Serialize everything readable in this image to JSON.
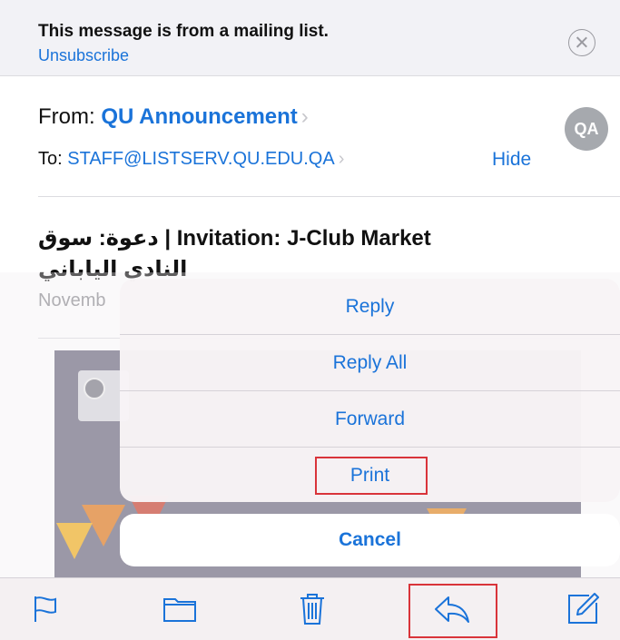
{
  "banner": {
    "message": "This message is from a mailing list.",
    "unsubscribe_label": "Unsubscribe",
    "close_icon": "close-circle-icon"
  },
  "header": {
    "from_prefix": "From:",
    "from_name": "QU Announcement",
    "to_prefix": "To:",
    "to_address": "STAFF@LISTSERV.QU.EDU.QA",
    "chevron": "›",
    "hide_label": "Hide",
    "avatar_initials": "QA"
  },
  "message": {
    "subject_line1": "دعوة: سوق | Invitation: J-Club Market",
    "subject_line2": "النادي الياباني",
    "date_partial": "Novemb"
  },
  "action_sheet": {
    "items": [
      "Reply",
      "Reply All",
      "Forward",
      "Print"
    ],
    "cancel_label": "Cancel",
    "highlighted_item": "Print"
  },
  "toolbar": {
    "icons": [
      "flag-icon",
      "folder-icon",
      "trash-icon",
      "reply-icon",
      "compose-icon"
    ],
    "highlighted_icon": "reply-icon"
  },
  "colors": {
    "accent": "#1a73d9",
    "highlight_box": "#d9343a",
    "banner_bg": "#f2f2f6",
    "toolbar_bg": "#f4f0f2"
  }
}
